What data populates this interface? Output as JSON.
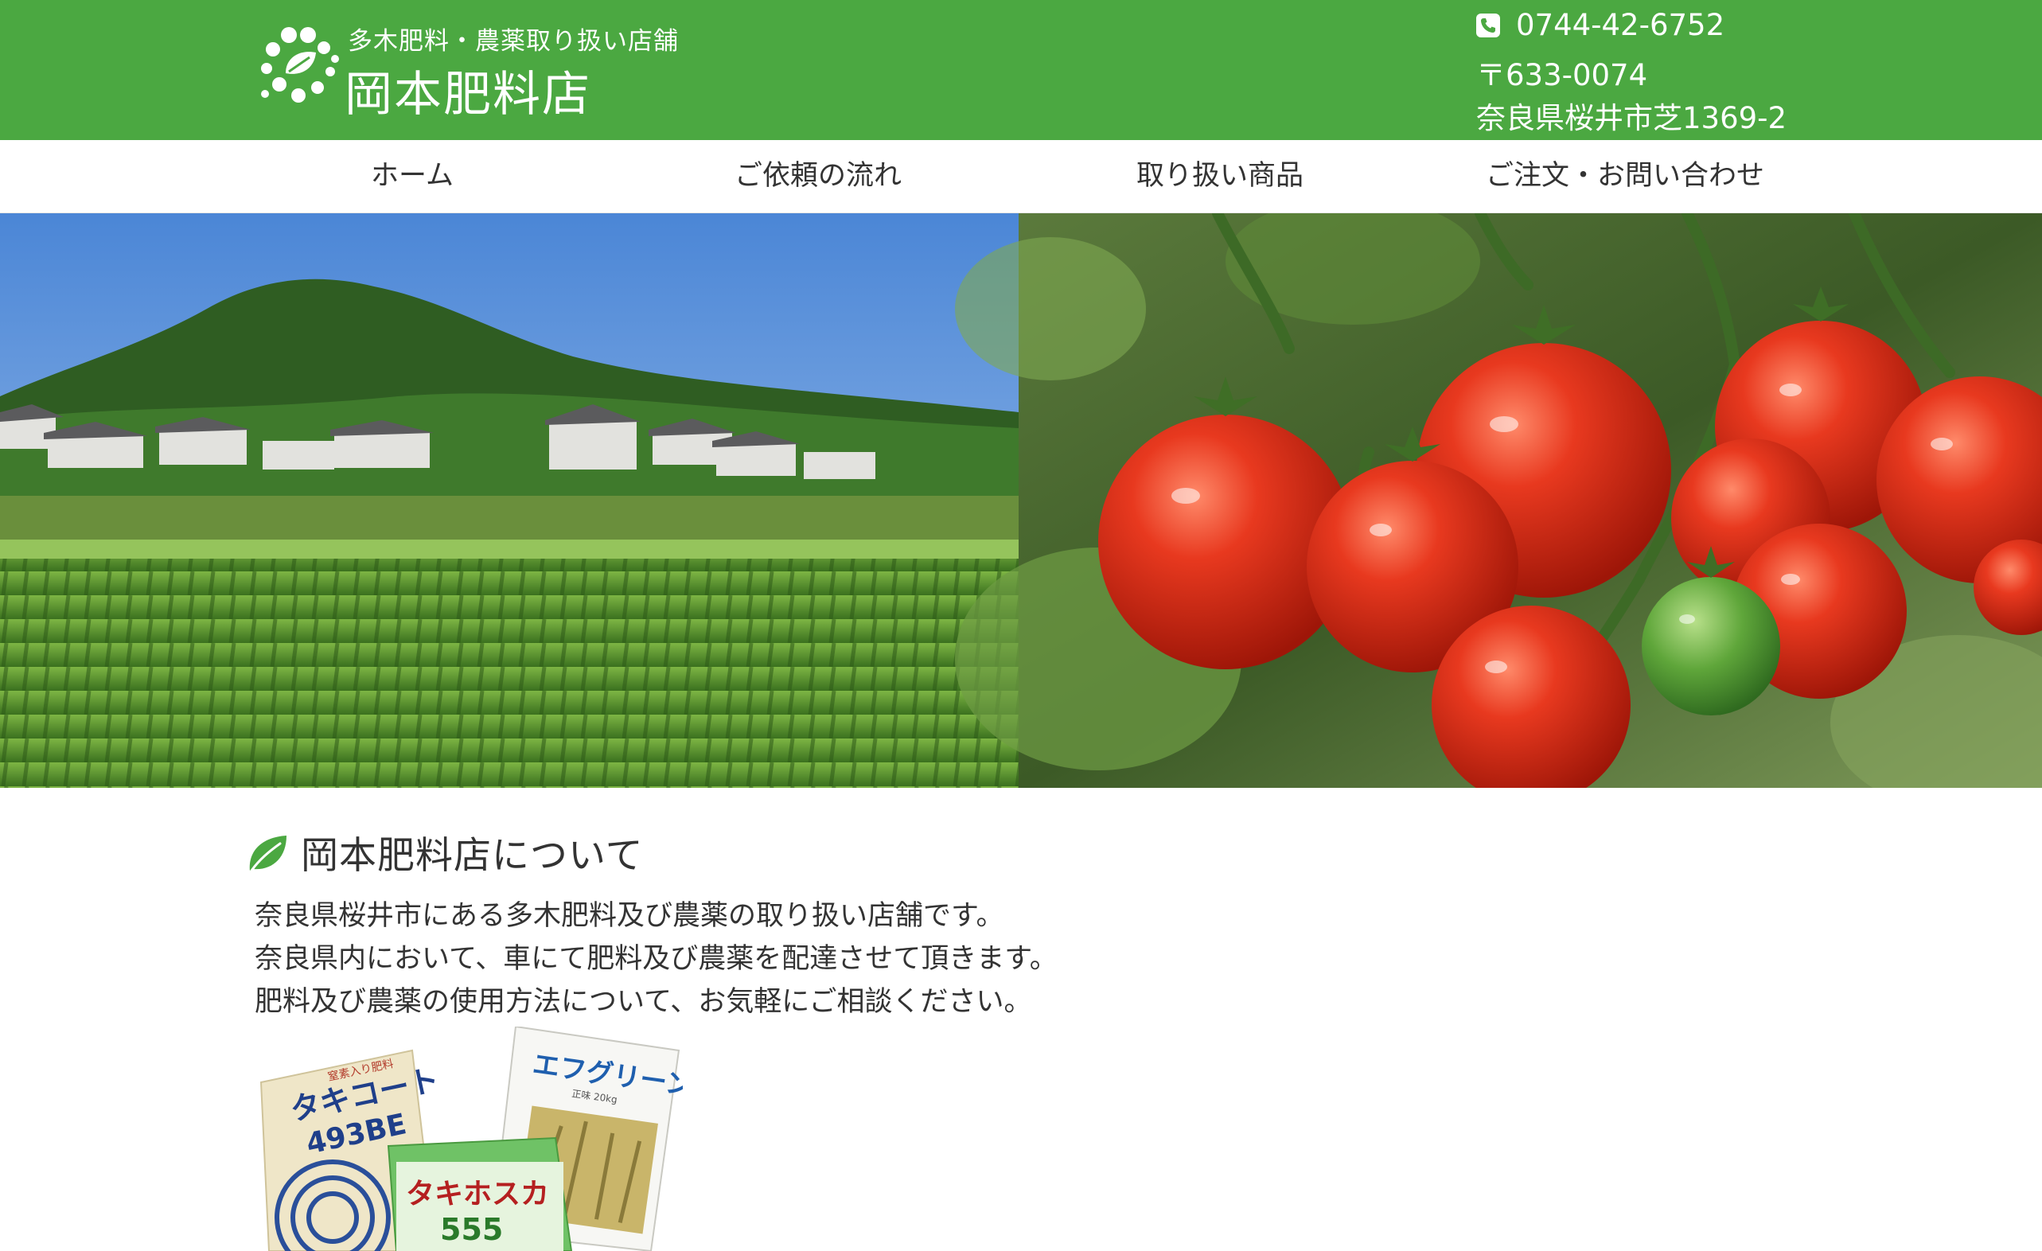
{
  "header": {
    "subtitle": "多木肥料・農薬取り扱い店舗",
    "title": "岡本肥料店",
    "phone": "0744-42-6752",
    "postal": "〒633-0074",
    "address": "奈良県桜井市芝1369-2"
  },
  "nav": {
    "items": [
      {
        "label": "ホーム"
      },
      {
        "label": "ご依頼の流れ"
      },
      {
        "label": "取り扱い商品"
      },
      {
        "label": "ご注文・お問い合わせ"
      }
    ]
  },
  "hero": {
    "left_image": "rice-field-mountain-photo",
    "right_image": "tomatoes-photo"
  },
  "about": {
    "heading": "岡本肥料店について",
    "lines": [
      "奈良県桜井市にある多木肥料及び農薬の取り扱い店舗です。",
      "奈良県内において、車にて肥料及び農薬を配達させて頂きます。",
      "肥料及び農薬の使用方法について、お気軽にご相談ください。"
    ]
  },
  "products": {
    "bag1_label": "タキコート",
    "bag1_code": "493BE",
    "bag1_top": "窒素入り肥料",
    "bag2_label": "エフグリーン",
    "bag2_weight": "正味 20kg",
    "bag3_label": "タキホスカ",
    "bag3_code": "555"
  },
  "colors": {
    "header_green": "#4ba841",
    "leaf_green": "#4ba841",
    "text": "#333333"
  },
  "icons": {
    "phone": "phone-icon",
    "leaf": "leaf-icon",
    "logo": "logo-mark-icon"
  }
}
